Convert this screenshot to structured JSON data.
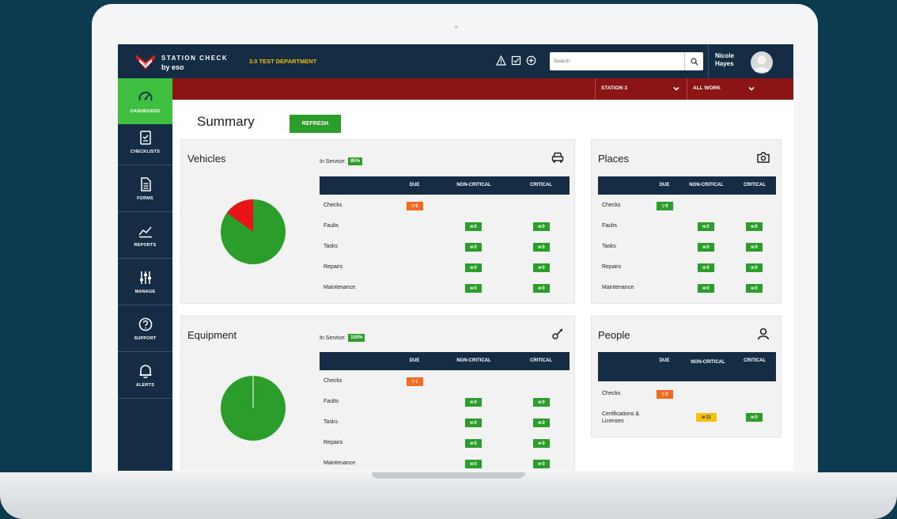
{
  "header": {
    "brand": "STATION CHECK",
    "brand_sub": "by eso",
    "department": "3.0 TEST DEPARTMENT",
    "search_placeholder": "Search",
    "user_name": "Nicole Hayes"
  },
  "filters": {
    "station": "STATION 3",
    "work": "ALL WORK"
  },
  "sidebar": {
    "items": [
      {
        "label": "DASHBOARD",
        "icon": "speedometer-icon",
        "active": true
      },
      {
        "label": "CHECKLISTS",
        "icon": "checklist-icon",
        "active": false
      },
      {
        "label": "FORMS",
        "icon": "document-icon",
        "active": false
      },
      {
        "label": "REPORTS",
        "icon": "chart-icon",
        "active": false
      },
      {
        "label": "MANAGE",
        "icon": "sliders-icon",
        "active": false
      },
      {
        "label": "SUPPORT",
        "icon": "help-icon",
        "active": false
      },
      {
        "label": "ALERTS",
        "icon": "bell-icon",
        "active": false
      }
    ]
  },
  "main": {
    "title": "Summary",
    "refresh_label": "REFRESH"
  },
  "colors": {
    "navy": "#142d45",
    "red_bar": "#8b1414",
    "green": "#2a9d2a",
    "orange": "#f26a21",
    "yellow": "#f5c010",
    "pie_red": "#e8141a"
  },
  "vehicles": {
    "title": "Vehicles",
    "in_service_label": "In Service:",
    "in_service_pct": "85%",
    "in_service_fraction": 0.85,
    "icon": "car-icon",
    "columns": [
      "DUE",
      "NON-CRITICAL",
      "CRITICAL"
    ],
    "rows": [
      {
        "label": "Checks",
        "due": "6",
        "noncritical": null,
        "critical": null
      },
      {
        "label": "Faults",
        "due": null,
        "noncritical": "0",
        "critical": "0"
      },
      {
        "label": "Tasks",
        "due": null,
        "noncritical": "0",
        "critical": "0"
      },
      {
        "label": "Repairs",
        "due": null,
        "noncritical": "0",
        "critical": "0"
      },
      {
        "label": "Maintenance",
        "due": null,
        "noncritical": "0",
        "critical": "0"
      }
    ]
  },
  "equipment": {
    "title": "Equipment",
    "in_service_label": "In Service:",
    "in_service_pct": "100%",
    "in_service_fraction": 1.0,
    "icon": "wrench-icon",
    "columns": [
      "DUE",
      "NON-CRITICAL",
      "CRITICAL"
    ],
    "rows": [
      {
        "label": "Checks",
        "due": "1",
        "noncritical": null,
        "critical": null
      },
      {
        "label": "Faults",
        "due": null,
        "noncritical": "0",
        "critical": "0"
      },
      {
        "label": "Tasks",
        "due": null,
        "noncritical": "0",
        "critical": "0"
      },
      {
        "label": "Repairs",
        "due": null,
        "noncritical": "0",
        "critical": "0"
      },
      {
        "label": "Maintenance",
        "due": null,
        "noncritical": "0",
        "critical": "0"
      }
    ]
  },
  "places": {
    "title": "Places",
    "icon": "camera-icon",
    "columns": [
      "DUE",
      "NON-CRITICAL",
      "CRITICAL"
    ],
    "rows": [
      {
        "label": "Checks",
        "due": "0",
        "noncritical": null,
        "critical": null
      },
      {
        "label": "Faults",
        "due": null,
        "noncritical": "0",
        "critical": "0"
      },
      {
        "label": "Tasks",
        "due": null,
        "noncritical": "0",
        "critical": "0"
      },
      {
        "label": "Repairs",
        "due": null,
        "noncritical": "0",
        "critical": "0"
      },
      {
        "label": "Maintenance",
        "due": null,
        "noncritical": "0",
        "critical": "0"
      }
    ]
  },
  "people": {
    "title": "People",
    "icon": "person-icon",
    "columns": [
      "DUE",
      "NON-CRITICAL",
      "CRITICAL"
    ],
    "rows": [
      {
        "label": "Checks",
        "due": "2"
      },
      {
        "label": "Certifications & Licenses",
        "noncritical": "11",
        "critical": "0"
      }
    ]
  }
}
